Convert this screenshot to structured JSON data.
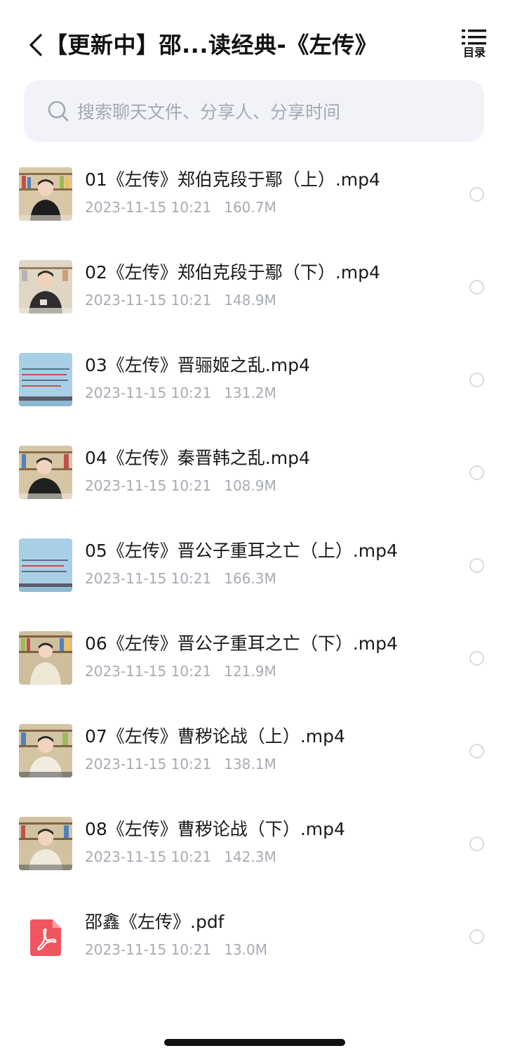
{
  "header": {
    "title": "【更新中】邵...读经典-《左传》",
    "toc_label": "目录"
  },
  "search": {
    "placeholder": "搜索聊天文件、分享人、分享时间"
  },
  "files": [
    {
      "name": "01《左传》郑伯克段于鄢（上）.mp4",
      "date": "2023-11-15 10:21",
      "size": "160.7M",
      "thumb": "person-shelf-icon"
    },
    {
      "name": "02《左传》郑伯克段于鄢（下）.mp4",
      "date": "2023-11-15 10:21",
      "size": "148.9M",
      "thumb": "person-shelf-icon"
    },
    {
      "name": "03《左传》晋骊姬之乱.mp4",
      "date": "2023-11-15 10:21",
      "size": "131.2M",
      "thumb": "slide-text-icon"
    },
    {
      "name": "04《左传》秦晋韩之乱.mp4",
      "date": "2023-11-15 10:21",
      "size": "108.9M",
      "thumb": "person-shelf-icon"
    },
    {
      "name": "05《左传》晋公子重耳之亡（上）.mp4",
      "date": "2023-11-15 10:21",
      "size": "166.3M",
      "thumb": "slide-text-icon"
    },
    {
      "name": "06《左传》晋公子重耳之亡（下）.mp4",
      "date": "2023-11-15 10:21",
      "size": "121.9M",
      "thumb": "person-shelf-icon"
    },
    {
      "name": "07《左传》曹秽论战（上）.mp4",
      "date": "2023-11-15 10:21",
      "size": "138.1M",
      "thumb": "person-shelf-icon"
    },
    {
      "name": "08《左传》曹秽论战（下）.mp4",
      "date": "2023-11-15 10:21",
      "size": "142.3M",
      "thumb": "person-shelf-icon"
    },
    {
      "name": "邵鑫《左传》.pdf",
      "date": "2023-11-15 10:21",
      "size": "13.0M",
      "thumb": "pdf-icon"
    }
  ],
  "colors": {
    "search_bg": "#f1f3f8",
    "meta_text": "#a7abb3",
    "pdf_red": "#f0565d",
    "slide_blue": "#a9cfe6"
  }
}
